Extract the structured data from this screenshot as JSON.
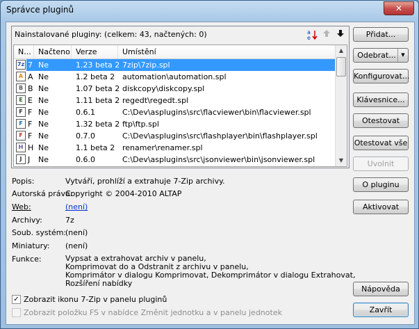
{
  "window": {
    "title": "Správce pluginů",
    "close_glyph": "✕"
  },
  "panel": {
    "header": "Nainstalované pluginy: (celkem: 43, načtených: 0)"
  },
  "columns": [
    "N...",
    "Načteno",
    "Verze",
    "Umístění"
  ],
  "rows": [
    {
      "icon": "7z",
      "name": "7",
      "loaded": "Ne",
      "version": "1.23 beta 2",
      "location": "7zip\\7zip.spl",
      "selected": true
    },
    {
      "icon": "A",
      "name": "A",
      "loaded": "Ne",
      "version": "1.2 beta 2",
      "location": "automation\\automation.spl"
    },
    {
      "icon": "B",
      "name": "B",
      "loaded": "Ne",
      "version": "1.07 beta 2",
      "location": "diskcopy\\diskcopy.spl"
    },
    {
      "icon": "E",
      "name": "E",
      "loaded": "Ne",
      "version": "1.11 beta 2",
      "location": "regedt\\regedt.spl"
    },
    {
      "icon": "F",
      "name": "F",
      "loaded": "Ne",
      "version": "0.6.1",
      "location": "C:\\Dev\\asplugins\\src\\flacviewer\\bin\\flacviewer.spl"
    },
    {
      "icon": "F",
      "name": "F",
      "loaded": "Ne",
      "version": "1.32 beta 2",
      "location": "ftp\\ftp.spl"
    },
    {
      "icon": "F",
      "name": "F",
      "loaded": "Ne",
      "version": "0.7.0",
      "location": "C:\\Dev\\asplugins\\src\\flashplayer\\bin\\flashplayer.spl"
    },
    {
      "icon": "H",
      "name": "H",
      "loaded": "Ne",
      "version": "1.1 beta 2",
      "location": "renamer\\renamer.spl"
    },
    {
      "icon": "J",
      "name": "J",
      "loaded": "Ne",
      "version": "0.6.0",
      "location": "C:\\Dev\\asplugins\\src\\jsonviewer\\bin\\jsonviewer.spl"
    }
  ],
  "buttons": {
    "add": "Přidat...",
    "remove": "Odebrat...",
    "configure": "Konfigurovat...",
    "keys": "Klávesnice...",
    "test": "Otestovat",
    "test_all": "Otestovat vše",
    "unload": "Uvolnit",
    "about": "O pluginu",
    "activate": "Aktivovat",
    "help": "Nápověda",
    "close": "Zavřít"
  },
  "details": {
    "description_label": "Popis:",
    "description": "Vytváří, prohlíží a extrahuje 7-Zip archivy.",
    "copyright_label": "Autorská práva:",
    "copyright": "Copyright © 2004-2010 ALTAP",
    "web_label": "Web:",
    "web": "(není)",
    "archives_label": "Archivy:",
    "archives": "7z",
    "fs_label": "Soub. systém:",
    "fs": "(není)",
    "thumbs_label": "Miniatury:",
    "thumbs": "(není)",
    "functions_label": "Funkce:",
    "functions": [
      "Vypsat a extrahovat archiv v panelu,",
      "Komprimovat do a Odstranit z archivu v panelu,",
      "Komprimátor v dialogu Komprimovat, Dekomprimátor v dialogu Extrahovat,",
      "Rozšíření nabídky"
    ]
  },
  "checkboxes": {
    "show_icon": "Zobrazit ikonu 7-Zip v panelu pluginů",
    "show_fs": "Zobrazit položku FS v nabídce Změnit jednotku a v panelu jednotek"
  }
}
